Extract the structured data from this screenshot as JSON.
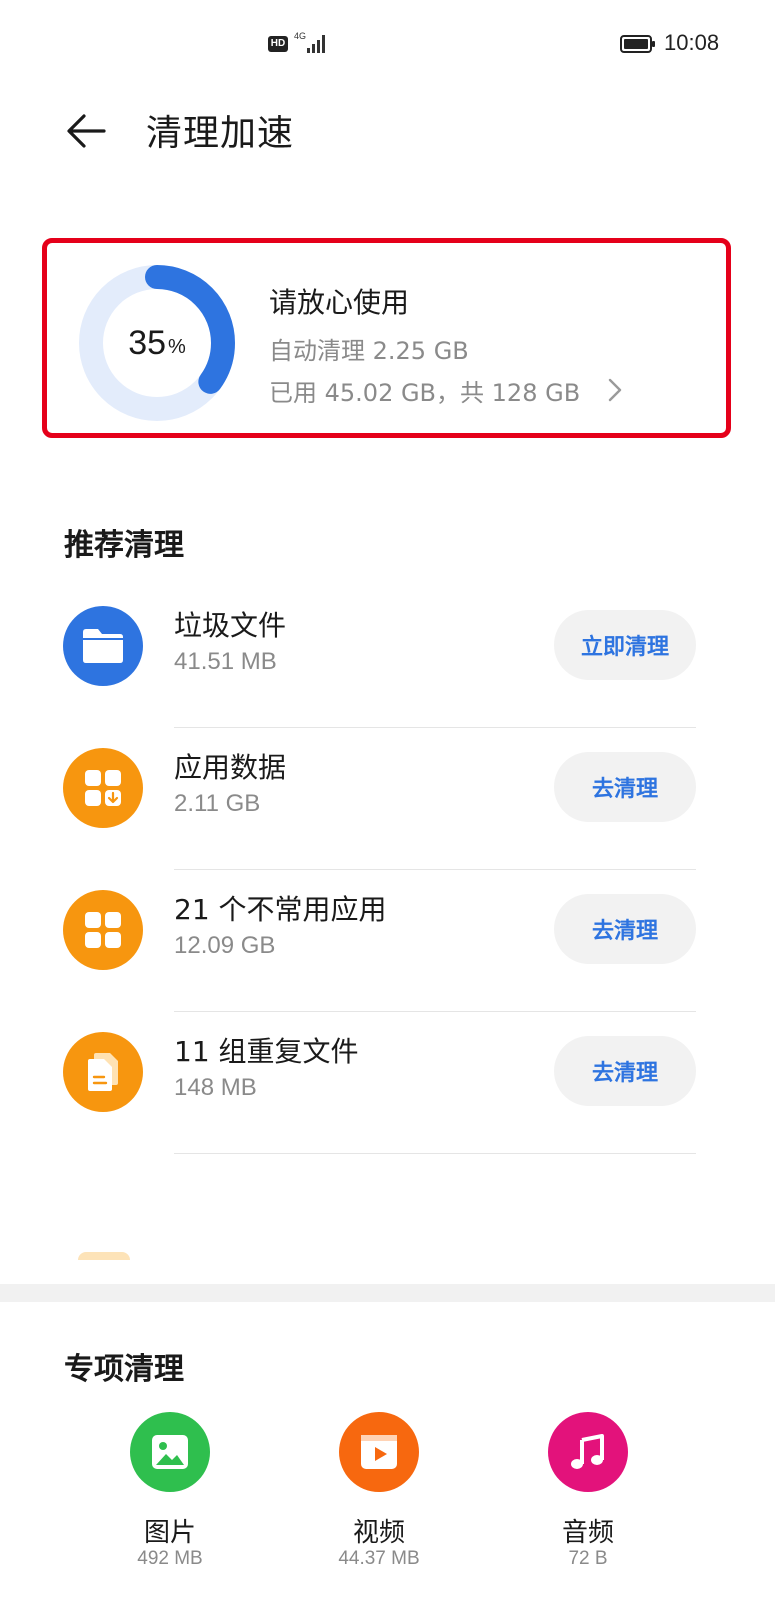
{
  "status_bar": {
    "hd": "HD",
    "network_top": "4G",
    "time": "10:08"
  },
  "header": {
    "title": "清理加速"
  },
  "storage": {
    "percent_value": "35",
    "percent_unit": "%",
    "used_fraction": 0.35,
    "status": "请放心使用",
    "auto_clean": "自动清理 2.25 GB",
    "usage": "已用 45.02 GB，共 128 GB",
    "ring_color": "#2e74e0",
    "ring_track_color": "#e3ecfb",
    "highlight_color": "#e5001a"
  },
  "recommended": {
    "title": "推荐清理",
    "items": [
      {
        "name": "垃圾文件",
        "size": "41.51 MB",
        "button": "立即清理",
        "icon": "folder-icon",
        "color": "#2e74e0"
      },
      {
        "name": "应用数据",
        "size": "2.11 GB",
        "button": "去清理",
        "icon": "app-data-icon",
        "color": "#f7960f"
      },
      {
        "name": "21 个不常用应用",
        "size": "12.09 GB",
        "button": "去清理",
        "icon": "apps-grid-icon",
        "color": "#f7960f"
      },
      {
        "name": "11 组重复文件",
        "size": "148 MB",
        "button": "去清理",
        "icon": "duplicate-files-icon",
        "color": "#f7960f"
      }
    ]
  },
  "special": {
    "title": "专项清理",
    "items": [
      {
        "name": "图片",
        "size": "492 MB",
        "icon": "image-icon",
        "color": "#2fbf4e"
      },
      {
        "name": "视频",
        "size": "44.37 MB",
        "icon": "video-icon",
        "color": "#f7680f"
      },
      {
        "name": "音频",
        "size": "72 B",
        "icon": "music-icon",
        "color": "#e3127b"
      }
    ]
  }
}
